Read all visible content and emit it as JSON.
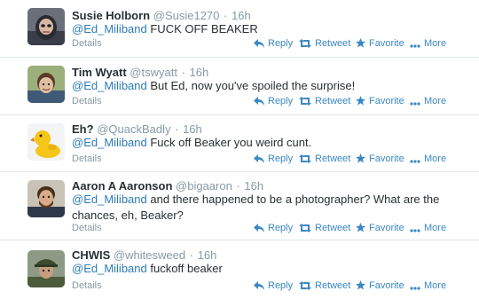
{
  "colors": {
    "link": "#2b7bb9",
    "action": "#3b88c3",
    "muted": "#8899a6",
    "text": "#292f33",
    "divider": "#e1e8ed"
  },
  "tweets": [
    {
      "name": "Susie Holborn",
      "handle": "@Susie1270",
      "separator": "·",
      "time": "16h",
      "mention": "@Ed_Miliband",
      "text": " FUCK OFF BEAKER",
      "avatar_icon": "avatar-photo-woman-icon"
    },
    {
      "name": "Tim Wyatt",
      "handle": "@tswyatt",
      "separator": "·",
      "time": "16h",
      "mention": "@Ed_Miliband",
      "text": " But Ed, now you've spoiled the surprise!",
      "avatar_icon": "avatar-photo-man-icon"
    },
    {
      "name": "Eh?",
      "handle": "@QuackBadly",
      "separator": "·",
      "time": "16h",
      "mention": "@Ed_Miliband",
      "text": " Fuck off Beaker you weird cunt.",
      "avatar_icon": "avatar-rubber-duck-icon"
    },
    {
      "name": "Aaron A Aaronson",
      "handle": "@bigaaron",
      "separator": "·",
      "time": "16h",
      "mention": "@Ed_Miliband",
      "text": " and there happened to be a photographer? What are the chances, eh, Beaker?",
      "avatar_icon": "avatar-photo-man-beard-icon"
    },
    {
      "name": "CHWIS",
      "handle": "@whitesweed",
      "separator": "·",
      "time": "16h",
      "mention": "@Ed_Miliband",
      "text": " fuckoff beaker",
      "avatar_icon": "avatar-photo-man-cap-icon"
    }
  ],
  "actions": {
    "details": "Details",
    "reply": "Reply",
    "retweet": "Retweet",
    "favorite": "Favorite",
    "more": "More"
  }
}
